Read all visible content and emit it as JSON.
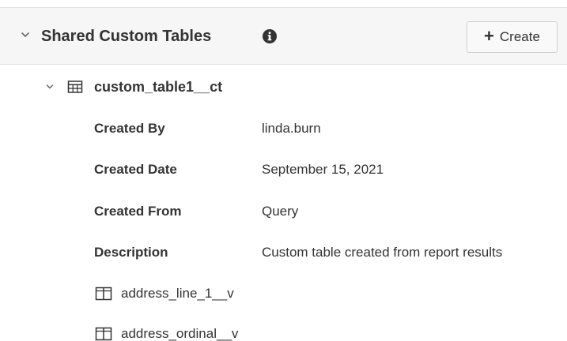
{
  "section": {
    "title": "Shared Custom Tables",
    "info_icon": "info-circle-icon",
    "chevron_icon": "chevron-down-icon",
    "create_icon": "plus-icon",
    "create_label": "Create"
  },
  "table": {
    "name": "custom_table1__ct",
    "icon": "table-grid-icon",
    "chevron_icon": "chevron-down-icon",
    "properties": [
      {
        "label": "Created By",
        "value": "linda.burn"
      },
      {
        "label": "Created Date",
        "value": "September 15, 2021"
      },
      {
        "label": "Created From",
        "value": "Query"
      },
      {
        "label": "Description",
        "value": "Custom table created from report results"
      }
    ],
    "columns": [
      {
        "name": "address_line_1__v",
        "icon": "column-icon"
      },
      {
        "name": "address_ordinal__v",
        "icon": "column-icon"
      }
    ]
  },
  "colors": {
    "header_background": "#f6f6f6",
    "border": "#e2e2e2",
    "text": "#333333"
  }
}
